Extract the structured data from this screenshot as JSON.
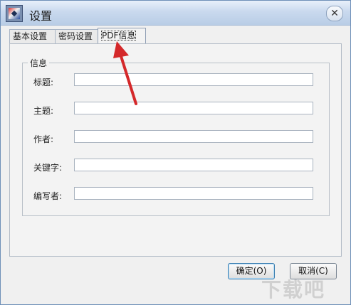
{
  "window": {
    "title": "设置"
  },
  "tabs": [
    {
      "label": "基本设置"
    },
    {
      "label": "密码设置"
    },
    {
      "label": "PDF信息",
      "active": true
    }
  ],
  "group": {
    "label": "信息"
  },
  "fields": [
    {
      "label": "标题:",
      "value": ""
    },
    {
      "label": "主题:",
      "value": ""
    },
    {
      "label": "作者:",
      "value": ""
    },
    {
      "label": "关键字:",
      "value": ""
    },
    {
      "label": "编写者:",
      "value": ""
    }
  ],
  "buttons": {
    "ok": "确定(O)",
    "cancel": "取消(C)"
  },
  "watermark": "下载吧",
  "colors": {
    "arrow": "#d4282a",
    "titlebar": "#c9d9ee"
  }
}
